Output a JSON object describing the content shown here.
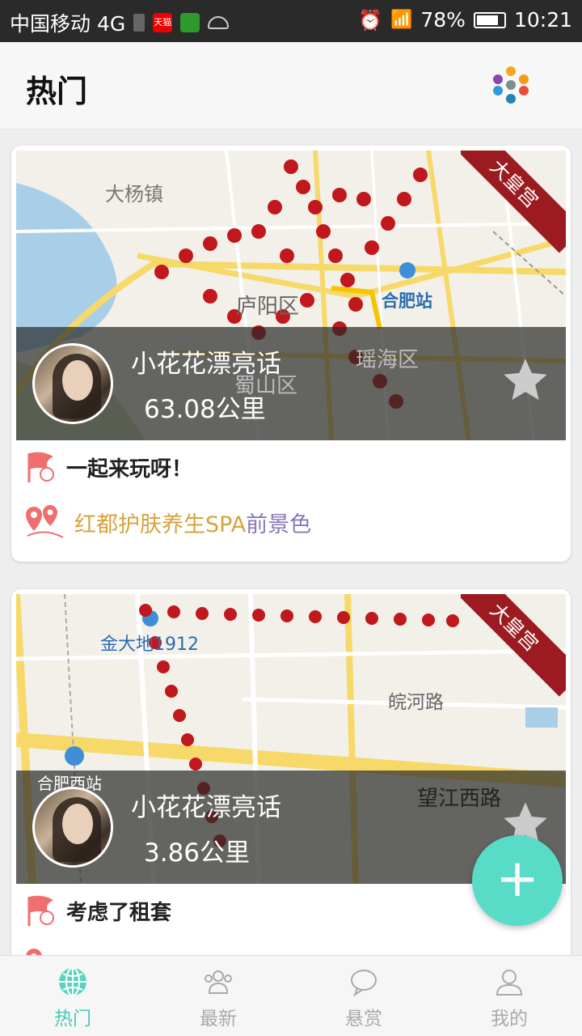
{
  "status_bar": {
    "carrier": "中国移动 4G",
    "app_badge": "天猫",
    "battery": "78%",
    "time": "10:21"
  },
  "header": {
    "title": "热门",
    "menu_icon": "colorful-dots-icon"
  },
  "posts": [
    {
      "ribbon": "大皇宫",
      "map_labels": [
        "大杨镇",
        "庐阳区",
        "合肥站",
        "瑶海区",
        "蜀山区"
      ],
      "username": "小花花漂亮话",
      "distance": "63.08公里",
      "message": "一起来玩呀！",
      "location_name": "红都护肤养生SPA",
      "location_extra": "前景色"
    },
    {
      "ribbon": "大皇宫",
      "map_labels": [
        "金大地1912",
        "皖河路",
        "合肥西站",
        "望江西路"
      ],
      "username": "小花花漂亮话",
      "distance": "3.86公里",
      "message": "考虑了租套",
      "location_name": "",
      "location_extra": ""
    }
  ],
  "fab": {
    "label": "+"
  },
  "tabs": [
    {
      "label": "热门",
      "icon": "globe-icon",
      "active": true
    },
    {
      "label": "最新",
      "icon": "people-icon",
      "active": false
    },
    {
      "label": "悬赏",
      "icon": "chat-bubble-icon",
      "active": false
    },
    {
      "label": "我的",
      "icon": "user-icon",
      "active": false
    }
  ],
  "colors": {
    "accent": "#49c9b6",
    "ribbon": "#9c1b20",
    "footprint": "#c0181c",
    "location_name": "#d9a23a",
    "location_extra": "#8878b8"
  }
}
